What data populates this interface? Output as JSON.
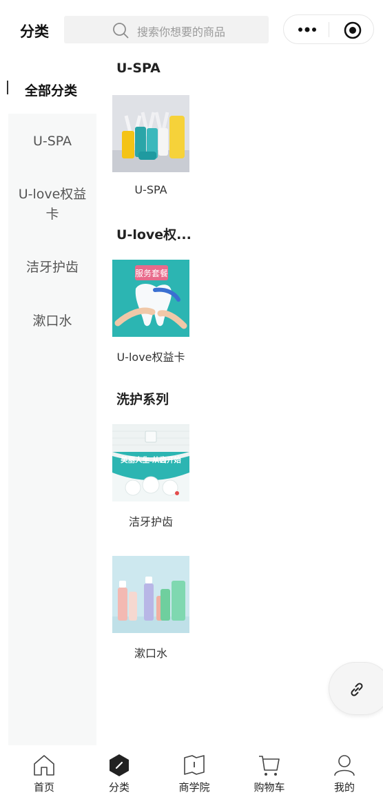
{
  "header": {
    "title": "分类",
    "search_placeholder": "搜索你想要的商品",
    "more_icon": "more-dots-icon",
    "target_icon": "record-target-icon"
  },
  "sidebar": {
    "all_label": "全部分类",
    "items": [
      {
        "label": "U-SPA"
      },
      {
        "label": "U-love权益卡"
      },
      {
        "label": "洁牙护齿"
      },
      {
        "label": "漱口水"
      }
    ]
  },
  "sections": [
    {
      "title": "U-SPA",
      "products": [
        {
          "name": "U-SPA"
        }
      ]
    },
    {
      "title": "U-love权...",
      "products": [
        {
          "name": "U-love权益卡",
          "thumb_text": "服务套餐"
        }
      ]
    },
    {
      "title": "洗护系列",
      "products": [
        {
          "name": "洁牙护齿",
          "thumb_text": "美丽人生 从齿开始"
        },
        {
          "name": "漱口水"
        }
      ]
    }
  ],
  "tabbar": {
    "items": [
      {
        "label": "首页",
        "icon": "home-icon"
      },
      {
        "label": "分类",
        "icon": "category-icon",
        "active": true
      },
      {
        "label": "商学院",
        "icon": "book-icon"
      },
      {
        "label": "购物车",
        "icon": "cart-icon"
      },
      {
        "label": "我的",
        "icon": "user-icon"
      }
    ]
  },
  "colors": {
    "accent": "#222222",
    "sidebar_bg": "#f7f8f8",
    "teal": "#2cb5b2"
  }
}
